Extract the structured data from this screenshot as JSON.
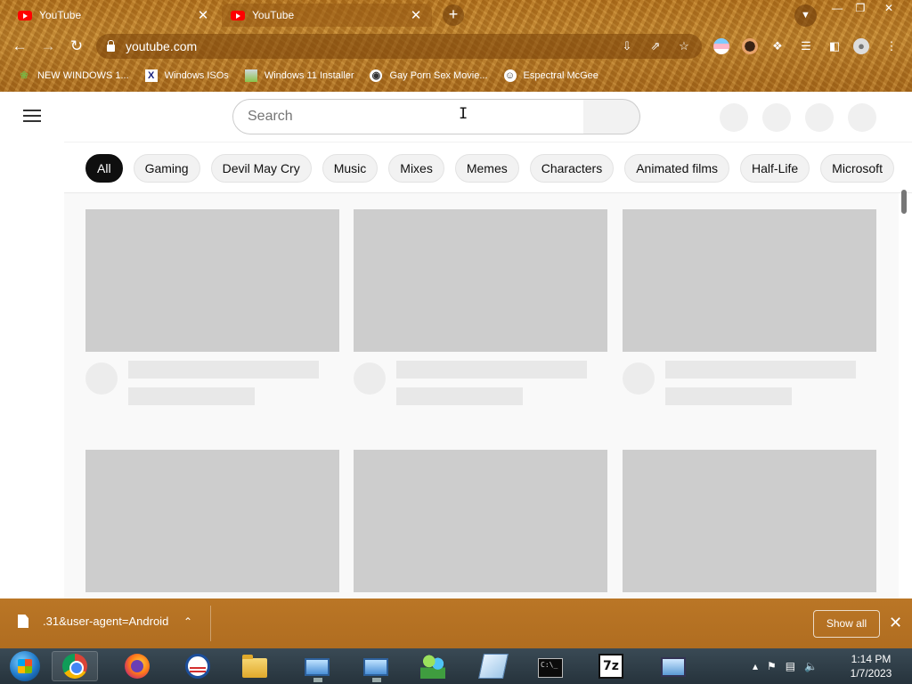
{
  "browser": {
    "tabs": [
      {
        "title": "YouTube",
        "active": false
      },
      {
        "title": "YouTube",
        "active": true
      }
    ],
    "new_tab_glyph": "+",
    "close_glyph": "✕",
    "address": "youtube.com",
    "bookmarks": [
      {
        "label": "NEW WINDOWS 1...",
        "icon": "leaf-icon"
      },
      {
        "label": "Windows ISOs",
        "icon": "x-logo-icon"
      },
      {
        "label": "Windows 11 Installer",
        "icon": "image-icon"
      },
      {
        "label": "Gay Porn Sex Movie...",
        "icon": "badge-icon"
      },
      {
        "label": "Espectral McGee",
        "icon": "avatar-icon"
      }
    ]
  },
  "youtube": {
    "search": {
      "placeholder": "Search"
    },
    "chips": [
      "All",
      "Gaming",
      "Devil May Cry",
      "Music",
      "Mixes",
      "Memes",
      "Characters",
      "Animated films",
      "Half-Life",
      "Microsoft"
    ]
  },
  "download_shelf": {
    "filename": ".31&user-agent=Android",
    "show_all": "Show all"
  },
  "taskbar": {
    "time": "1:14 PM",
    "date": "1/7/2023",
    "cmd_text": "C:\\_"
  },
  "colors": {
    "chrome_bg": "#b8751e",
    "chip_active": "#0f0f0f",
    "placeholder": "#cdcdcd",
    "youtube_red": "#ff0000"
  }
}
